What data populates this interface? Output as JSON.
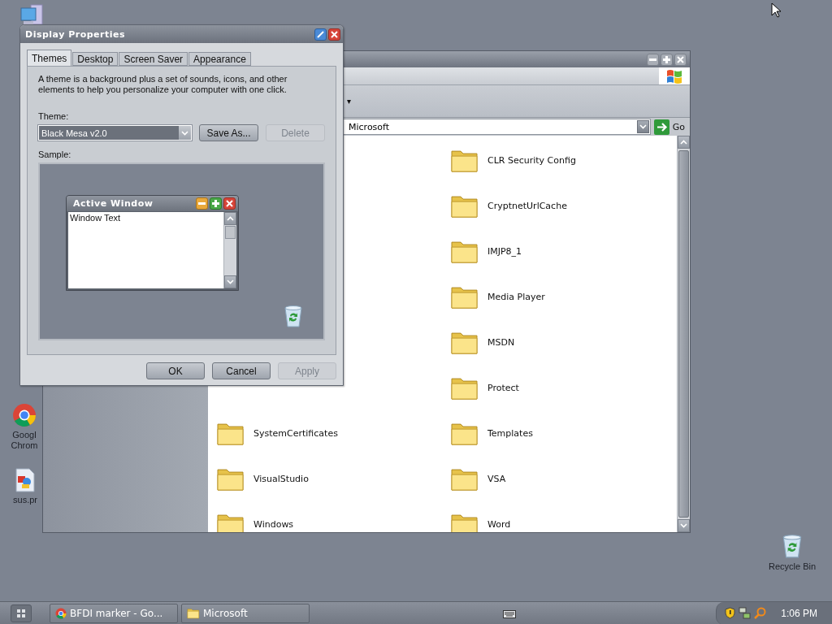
{
  "desktop_icons": [
    {
      "kind": "computer"
    },
    {
      "kind": "browser",
      "label": "Googl Chrom"
    },
    {
      "kind": "image-file",
      "label": "sus.pr"
    },
    {
      "kind": "recycle",
      "label": "Recycle Bin"
    }
  ],
  "explorer": {
    "toolbar_text": "▾",
    "address": "Microsoft",
    "go_label": "Go",
    "left_column": [
      {
        "name": "SystemCertificates"
      },
      {
        "name": "VisualStudio"
      },
      {
        "name": "Windows"
      }
    ],
    "right_column": [
      {
        "name": "CLR Security Config"
      },
      {
        "name": "CryptnetUrlCache"
      },
      {
        "name": "IMJP8_1"
      },
      {
        "name": "Media Player"
      },
      {
        "name": "MSDN"
      },
      {
        "name": "Protect"
      },
      {
        "name": "Templates"
      },
      {
        "name": "VSA"
      },
      {
        "name": "Word"
      }
    ]
  },
  "dialog": {
    "title": "Display Properties",
    "tabs": [
      {
        "label": "Themes",
        "selected": true
      },
      {
        "label": "Desktop",
        "selected": false
      },
      {
        "label": "Screen Saver",
        "selected": false
      },
      {
        "label": "Appearance",
        "selected": false
      }
    ],
    "description": "A theme is a background plus a set of sounds, icons, and other elements to help you personalize your computer with one click.",
    "theme_label": "Theme:",
    "theme_value": "Black Mesa v2.0",
    "theme_buttons": [
      {
        "label": "Save As...",
        "disabled": false
      },
      {
        "label": "Delete",
        "disabled": true
      }
    ],
    "sample_label": "Sample:",
    "sample_window": {
      "title": "Active Window",
      "text": "Window Text"
    },
    "buttons": [
      {
        "label": "OK",
        "disabled": false
      },
      {
        "label": "Cancel",
        "disabled": false
      },
      {
        "label": "Apply",
        "disabled": true
      }
    ]
  },
  "taskbar": {
    "tasks": [
      {
        "kind": "browser",
        "label": "BFDI marker - Go..."
      },
      {
        "kind": "folder",
        "label": "Microsoft"
      }
    ],
    "clock": "1:06 PM"
  }
}
